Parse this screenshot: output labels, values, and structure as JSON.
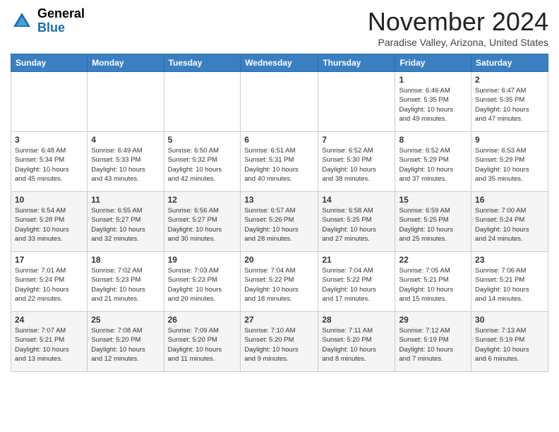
{
  "header": {
    "logo_general": "General",
    "logo_blue": "Blue",
    "month_title": "November 2024",
    "location": "Paradise Valley, Arizona, United States"
  },
  "calendar": {
    "days_of_week": [
      "Sunday",
      "Monday",
      "Tuesday",
      "Wednesday",
      "Thursday",
      "Friday",
      "Saturday"
    ],
    "weeks": [
      [
        {
          "day": "",
          "info": ""
        },
        {
          "day": "",
          "info": ""
        },
        {
          "day": "",
          "info": ""
        },
        {
          "day": "",
          "info": ""
        },
        {
          "day": "",
          "info": ""
        },
        {
          "day": "1",
          "info": "Sunrise: 6:46 AM\nSunset: 5:35 PM\nDaylight: 10 hours\nand 49 minutes."
        },
        {
          "day": "2",
          "info": "Sunrise: 6:47 AM\nSunset: 5:35 PM\nDaylight: 10 hours\nand 47 minutes."
        }
      ],
      [
        {
          "day": "3",
          "info": "Sunrise: 6:48 AM\nSunset: 5:34 PM\nDaylight: 10 hours\nand 45 minutes."
        },
        {
          "day": "4",
          "info": "Sunrise: 6:49 AM\nSunset: 5:33 PM\nDaylight: 10 hours\nand 43 minutes."
        },
        {
          "day": "5",
          "info": "Sunrise: 6:50 AM\nSunset: 5:32 PM\nDaylight: 10 hours\nand 42 minutes."
        },
        {
          "day": "6",
          "info": "Sunrise: 6:51 AM\nSunset: 5:31 PM\nDaylight: 10 hours\nand 40 minutes."
        },
        {
          "day": "7",
          "info": "Sunrise: 6:52 AM\nSunset: 5:30 PM\nDaylight: 10 hours\nand 38 minutes."
        },
        {
          "day": "8",
          "info": "Sunrise: 6:52 AM\nSunset: 5:29 PM\nDaylight: 10 hours\nand 37 minutes."
        },
        {
          "day": "9",
          "info": "Sunrise: 6:53 AM\nSunset: 5:29 PM\nDaylight: 10 hours\nand 35 minutes."
        }
      ],
      [
        {
          "day": "10",
          "info": "Sunrise: 6:54 AM\nSunset: 5:28 PM\nDaylight: 10 hours\nand 33 minutes."
        },
        {
          "day": "11",
          "info": "Sunrise: 6:55 AM\nSunset: 5:27 PM\nDaylight: 10 hours\nand 32 minutes."
        },
        {
          "day": "12",
          "info": "Sunrise: 6:56 AM\nSunset: 5:27 PM\nDaylight: 10 hours\nand 30 minutes."
        },
        {
          "day": "13",
          "info": "Sunrise: 6:57 AM\nSunset: 5:26 PM\nDaylight: 10 hours\nand 28 minutes."
        },
        {
          "day": "14",
          "info": "Sunrise: 6:58 AM\nSunset: 5:25 PM\nDaylight: 10 hours\nand 27 minutes."
        },
        {
          "day": "15",
          "info": "Sunrise: 6:59 AM\nSunset: 5:25 PM\nDaylight: 10 hours\nand 25 minutes."
        },
        {
          "day": "16",
          "info": "Sunrise: 7:00 AM\nSunset: 5:24 PM\nDaylight: 10 hours\nand 24 minutes."
        }
      ],
      [
        {
          "day": "17",
          "info": "Sunrise: 7:01 AM\nSunset: 5:24 PM\nDaylight: 10 hours\nand 22 minutes."
        },
        {
          "day": "18",
          "info": "Sunrise: 7:02 AM\nSunset: 5:23 PM\nDaylight: 10 hours\nand 21 minutes."
        },
        {
          "day": "19",
          "info": "Sunrise: 7:03 AM\nSunset: 5:23 PM\nDaylight: 10 hours\nand 20 minutes."
        },
        {
          "day": "20",
          "info": "Sunrise: 7:04 AM\nSunset: 5:22 PM\nDaylight: 10 hours\nand 18 minutes."
        },
        {
          "day": "21",
          "info": "Sunrise: 7:04 AM\nSunset: 5:22 PM\nDaylight: 10 hours\nand 17 minutes."
        },
        {
          "day": "22",
          "info": "Sunrise: 7:05 AM\nSunset: 5:21 PM\nDaylight: 10 hours\nand 15 minutes."
        },
        {
          "day": "23",
          "info": "Sunrise: 7:06 AM\nSunset: 5:21 PM\nDaylight: 10 hours\nand 14 minutes."
        }
      ],
      [
        {
          "day": "24",
          "info": "Sunrise: 7:07 AM\nSunset: 5:21 PM\nDaylight: 10 hours\nand 13 minutes."
        },
        {
          "day": "25",
          "info": "Sunrise: 7:08 AM\nSunset: 5:20 PM\nDaylight: 10 hours\nand 12 minutes."
        },
        {
          "day": "26",
          "info": "Sunrise: 7:09 AM\nSunset: 5:20 PM\nDaylight: 10 hours\nand 11 minutes."
        },
        {
          "day": "27",
          "info": "Sunrise: 7:10 AM\nSunset: 5:20 PM\nDaylight: 10 hours\nand 9 minutes."
        },
        {
          "day": "28",
          "info": "Sunrise: 7:11 AM\nSunset: 5:20 PM\nDaylight: 10 hours\nand 8 minutes."
        },
        {
          "day": "29",
          "info": "Sunrise: 7:12 AM\nSunset: 5:19 PM\nDaylight: 10 hours\nand 7 minutes."
        },
        {
          "day": "30",
          "info": "Sunrise: 7:13 AM\nSunset: 5:19 PM\nDaylight: 10 hours\nand 6 minutes."
        }
      ]
    ]
  }
}
